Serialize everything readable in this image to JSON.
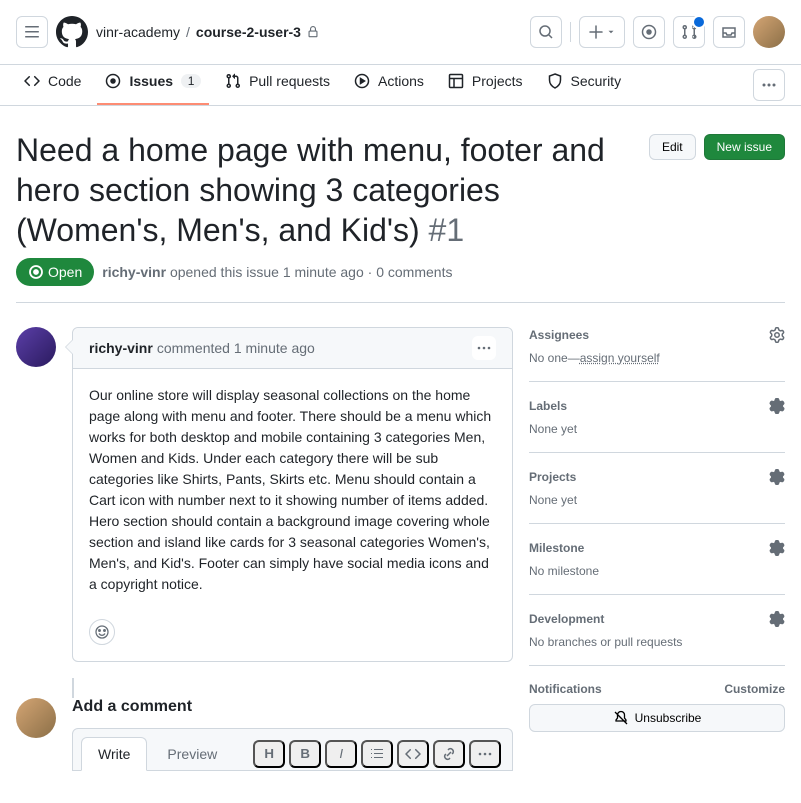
{
  "header": {
    "owner": "vinr-academy",
    "repo": "course-2-user-3"
  },
  "tabs": {
    "code": "Code",
    "issues": "Issues",
    "issues_count": "1",
    "pulls": "Pull requests",
    "actions": "Actions",
    "projects": "Projects",
    "security": "Security"
  },
  "issue": {
    "title": "Need a home page with menu, footer and hero section showing 3 categories (Women's, Men's, and Kid's)",
    "number": "#1",
    "edit_btn": "Edit",
    "new_issue_btn": "New issue",
    "state": "Open",
    "author": "richy-vinr",
    "opened_text": "opened this issue",
    "time": "1 minute ago",
    "comments_text": "0 comments"
  },
  "comment": {
    "author": "richy-vinr",
    "action": "commented",
    "time": "1 minute ago",
    "body": "Our online store will display seasonal collections on the home page along with menu and footer. There should be a menu which works for both desktop and mobile containing 3 categories Men, Women and Kids. Under each category there will be sub categories like Shirts, Pants, Skirts etc. Menu should contain a Cart icon with number next to it showing number of items added. Hero section should contain a background image covering whole section and island like cards for 3 seasonal categories Women's, Men's, and Kid's. Footer can simply have social media icons and a copyright notice."
  },
  "add_comment": {
    "title": "Add a comment",
    "write_tab": "Write",
    "preview_tab": "Preview"
  },
  "sidebar": {
    "assignees": {
      "title": "Assignees",
      "value": "No one—",
      "link": "assign yourself"
    },
    "labels": {
      "title": "Labels",
      "value": "None yet"
    },
    "projects": {
      "title": "Projects",
      "value": "None yet"
    },
    "milestone": {
      "title": "Milestone",
      "value": "No milestone"
    },
    "development": {
      "title": "Development",
      "value": "No branches or pull requests"
    },
    "notifications": {
      "title": "Notifications",
      "customize": "Customize",
      "unsubscribe": "Unsubscribe"
    }
  }
}
